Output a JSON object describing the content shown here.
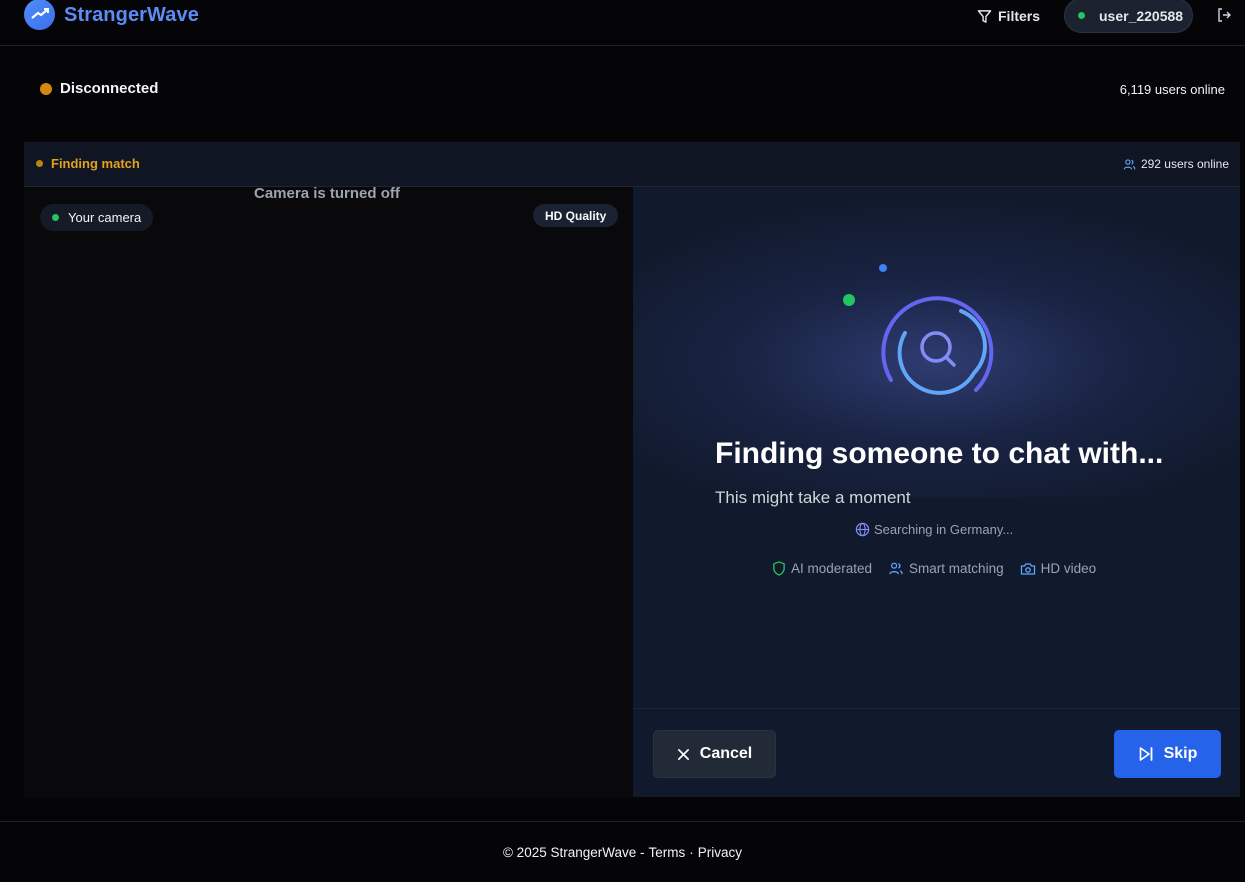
{
  "header": {
    "brand": "StrangerWave",
    "filters_label": "Filters",
    "username": "user_220588"
  },
  "status": {
    "connection": "Disconnected",
    "users_online": "6,119 users online"
  },
  "match_bar": {
    "label": "Finding match",
    "users_online": "292 users online"
  },
  "local_video": {
    "camera_label": "Your camera",
    "camera_off_text": "Camera is turned off",
    "quality_badge": "HD Quality"
  },
  "search_panel": {
    "heading": "Finding someone to chat with...",
    "subheading": "This might take a moment",
    "searching_text": "Searching in Germany...",
    "features": [
      {
        "icon": "shield-icon",
        "label": "AI moderated"
      },
      {
        "icon": "users-icon",
        "label": "Smart matching"
      },
      {
        "icon": "camera-icon",
        "label": "HD video"
      }
    ]
  },
  "actions": {
    "cancel_label": "Cancel",
    "skip_label": "Skip"
  },
  "footer": {
    "copyright": "© 2025 StrangerWave -",
    "terms": "Terms",
    "separator": "·",
    "privacy": "Privacy"
  },
  "colors": {
    "brand": "#5b8cf6",
    "accent_blue": "#2563eb",
    "warning_amber": "#d4880f",
    "online_green": "#22c55e"
  }
}
